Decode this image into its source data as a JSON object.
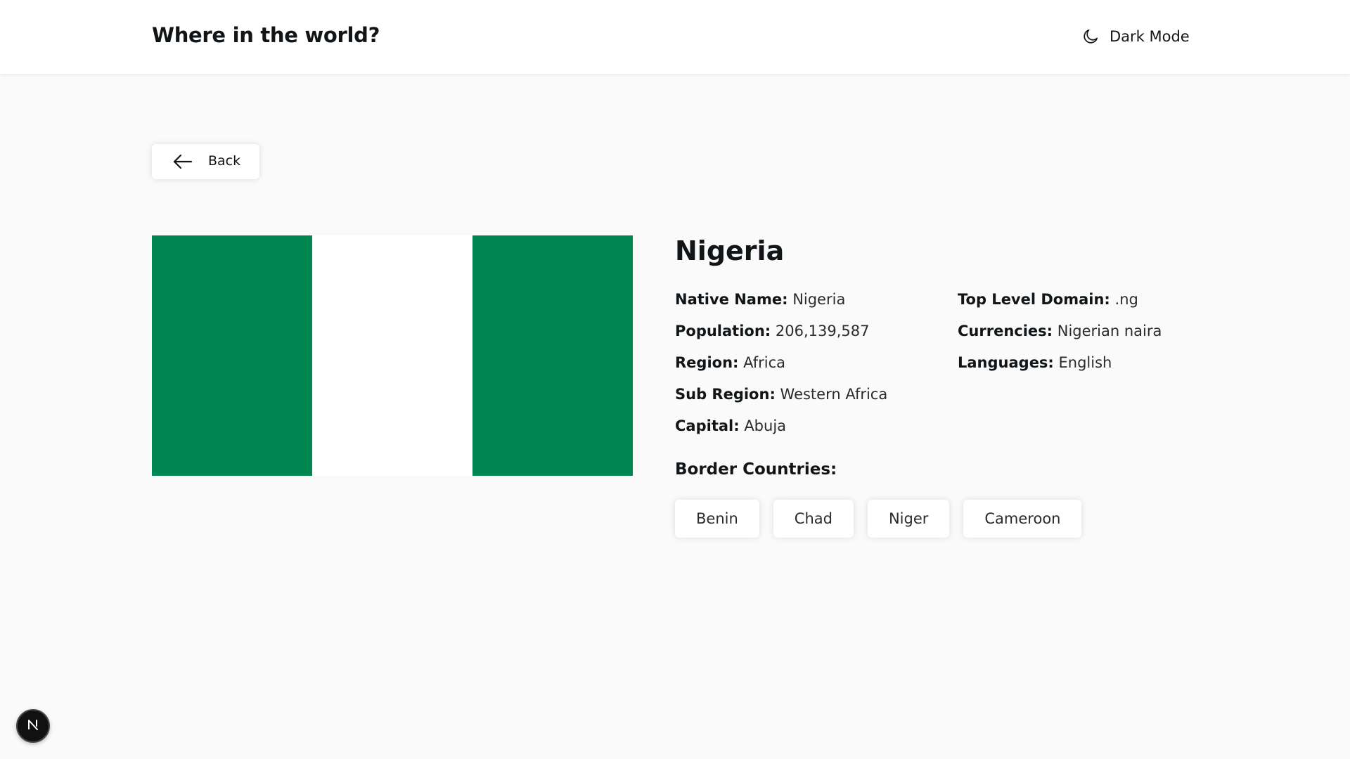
{
  "header": {
    "title": "Where in the world?",
    "theme_toggle": {
      "icon": "moon-icon",
      "label": "Dark Mode"
    }
  },
  "back_button": {
    "icon": "arrow-left-icon",
    "label": "Back"
  },
  "flag": {
    "alt_country": "Nigeria",
    "colors": [
      "#008751",
      "#ffffff",
      "#008751"
    ]
  },
  "country": {
    "name": "Nigeria",
    "left_info": [
      {
        "key": "Native Name:",
        "value": "Nigeria"
      },
      {
        "key": "Population:",
        "value": "206,139,587"
      },
      {
        "key": "Region:",
        "value": "Africa"
      },
      {
        "key": "Sub Region:",
        "value": "Western Africa"
      },
      {
        "key": "Capital:",
        "value": "Abuja"
      }
    ],
    "right_info": [
      {
        "key": "Top Level Domain:",
        "value": ".ng"
      },
      {
        "key": "Currencies:",
        "value": "Nigerian naira"
      },
      {
        "key": "Languages:",
        "value": "English"
      }
    ],
    "border_heading": "Border Countries:",
    "borders": [
      "Benin",
      "Chad",
      "Niger",
      "Cameroon"
    ]
  },
  "dev_badge": {
    "icon": "nextjs-logo-icon",
    "letter": "N"
  },
  "colors": {
    "background": "#fafafa",
    "surface": "#ffffff",
    "text": "#111517",
    "flag_green": "#008751"
  }
}
